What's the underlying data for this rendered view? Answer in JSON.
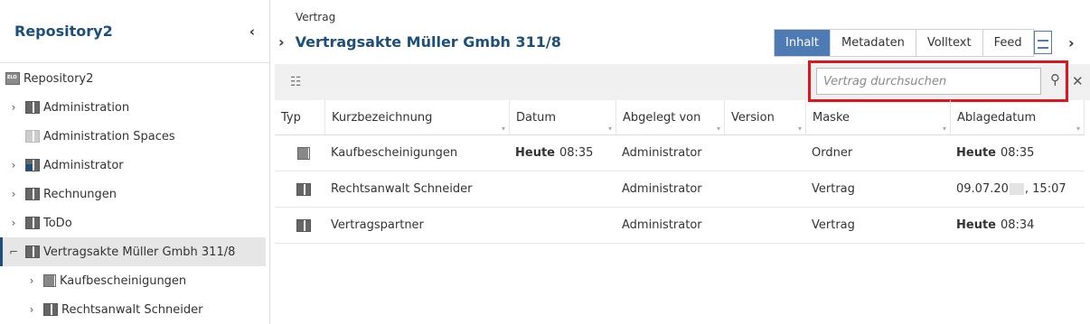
{
  "sidebar": {
    "title": "Repository2",
    "collapse_icon": "chevron-left-icon",
    "items": [
      {
        "label": "Repository2",
        "icon": "repository-icon",
        "expander": ""
      },
      {
        "label": "Administration",
        "icon": "cabinet-icon",
        "expander": "›"
      },
      {
        "label": "Administration Spaces",
        "icon": "cabinet-light-icon",
        "expander": ""
      },
      {
        "label": "Administrator",
        "icon": "user-cabinet-icon",
        "expander": "›"
      },
      {
        "label": "Rechnungen",
        "icon": "cabinet-icon",
        "expander": "›"
      },
      {
        "label": "ToDo",
        "icon": "cabinet-icon",
        "expander": "›"
      },
      {
        "label": "Vertragsakte Müller Gmbh 311/8",
        "icon": "cabinet-icon",
        "expander": "⌐",
        "selected": true
      },
      {
        "label": "Kaufbescheinigungen",
        "icon": "folder-icon",
        "expander": "›"
      },
      {
        "label": "Rechtsanwalt Schneider",
        "icon": "cabinet-icon",
        "expander": "›"
      }
    ]
  },
  "header": {
    "breadcrumb": "Vertrag",
    "title": "Vertragsakte Müller Gmbh 311/8",
    "tabs": [
      {
        "label": "Inhalt",
        "active": true
      },
      {
        "label": "Metadaten",
        "active": false
      },
      {
        "label": "Volltext",
        "active": false
      },
      {
        "label": "Feed",
        "active": false
      }
    ]
  },
  "search": {
    "placeholder": "Vertrag durchsuchen"
  },
  "table": {
    "columns": [
      "Typ",
      "Kurzbezeichnung",
      "Datum",
      "Abgelegt von",
      "Version",
      "Maske",
      "Ablagedatum"
    ],
    "rows": [
      {
        "icon": "folder-icon",
        "name": "Kaufbescheinigungen",
        "date_prefix": "Heute",
        "date_time": "08:35",
        "filed_by": "Administrator",
        "version": "",
        "mask": "Ordner",
        "filed_prefix": "Heute",
        "filed_time": "08:35"
      },
      {
        "icon": "cabinet-icon",
        "name": "Rechtsanwalt Schneider",
        "date_prefix": "",
        "date_time": "",
        "filed_by": "Administrator",
        "version": "",
        "mask": "Vertrag",
        "filed_prefix": "",
        "filed_date_start": "09.07.20",
        "filed_date_end": ", 15:07"
      },
      {
        "icon": "cabinet-icon",
        "name": "Vertragspartner",
        "date_prefix": "",
        "date_time": "",
        "filed_by": "Administrator",
        "version": "",
        "mask": "Vertrag",
        "filed_prefix": "Heute",
        "filed_time": "08:34"
      }
    ]
  },
  "colors": {
    "accent": "#1d4f7c",
    "tab_active": "#4e7bb3",
    "highlight": "#e0141e"
  }
}
